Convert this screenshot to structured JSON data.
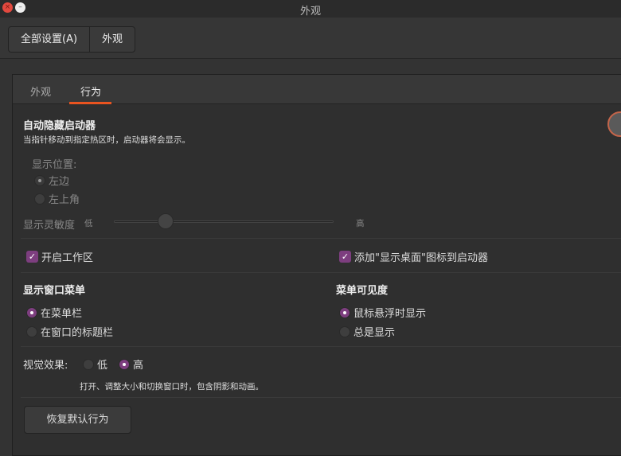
{
  "window": {
    "title": "外观",
    "close_icon": "×",
    "minimize_icon": "–"
  },
  "breadcrumb": [
    "全部设置(A)",
    "外观"
  ],
  "tabs": [
    "外观",
    "行为"
  ],
  "autohide": {
    "title": "自动隐藏启动器",
    "desc": "当指针移动到指定热区时，启动器将会显示。",
    "enabled": false,
    "position_label": "显示位置:",
    "positions": [
      "左边",
      "左上角"
    ],
    "sensitivity_label": "显示灵敏度",
    "low": "低",
    "high": "高",
    "sensitivity": 0.25
  },
  "workspaces": "开启工作区",
  "show_desktop": "添加\"显示桌面\"图标到启动器",
  "window_menu": {
    "title": "显示窗口菜单",
    "options": [
      "在菜单栏",
      "在窗口的标题栏"
    ]
  },
  "menu_visibility": {
    "title": "菜单可见度",
    "options": [
      "鼠标悬浮时显示",
      "总是显示"
    ]
  },
  "visual": {
    "label": "视觉效果:",
    "options": [
      "低",
      "高"
    ],
    "desc": "打开、调整大小和切换窗口时，包含阴影和动画。"
  },
  "restore_button": "恢复默认行为",
  "check_mark": "✓"
}
